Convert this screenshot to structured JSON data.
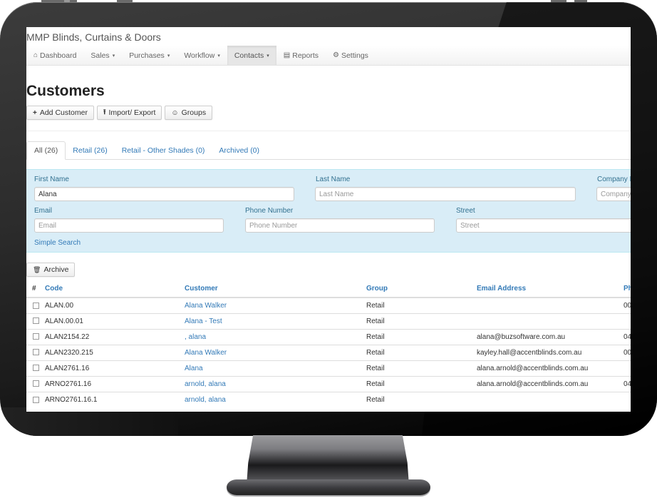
{
  "app": {
    "title": "MMP Blinds, Curtains & Doors"
  },
  "nav": {
    "items": [
      {
        "label": "Dashboard",
        "icon": "home-icon",
        "glyph": "⌂",
        "caret": ""
      },
      {
        "label": "Sales",
        "icon": "",
        "glyph": "",
        "caret": "▾"
      },
      {
        "label": "Purchases",
        "icon": "",
        "glyph": "",
        "caret": "▾"
      },
      {
        "label": "Workflow",
        "icon": "",
        "glyph": "",
        "caret": "▾"
      },
      {
        "label": "Contacts",
        "icon": "",
        "glyph": "",
        "caret": "▾",
        "active": true
      },
      {
        "label": "Reports",
        "icon": "bar-chart-icon",
        "glyph": "▤",
        "caret": ""
      },
      {
        "label": "Settings",
        "icon": "gears-icon",
        "glyph": "⚙",
        "caret": ""
      }
    ]
  },
  "page": {
    "title": "Customers"
  },
  "toolbar": {
    "add_customer": {
      "label": "Add Customer",
      "glyph": "+"
    },
    "import_export": {
      "label": "Import/ Export",
      "glyph": "⭱"
    },
    "groups": {
      "label": "Groups",
      "glyph": "☺"
    }
  },
  "tabs": [
    {
      "label": "All (26)",
      "active": true
    },
    {
      "label": "Retail (26)"
    },
    {
      "label": "Retail - Other Shades (0)"
    },
    {
      "label": "Archived (0)"
    }
  ],
  "search": {
    "first_name": {
      "label": "First Name",
      "value": "Alana",
      "placeholder": "First Name"
    },
    "last_name": {
      "label": "Last Name",
      "value": "",
      "placeholder": "Last Name"
    },
    "company_name": {
      "label": "Company Name",
      "value": "",
      "placeholder": "Company Name"
    },
    "email": {
      "label": "Email",
      "value": "",
      "placeholder": "Email"
    },
    "phone": {
      "label": "Phone Number",
      "value": "",
      "placeholder": "Phone Number"
    },
    "street": {
      "label": "Street",
      "value": "",
      "placeholder": "Street"
    },
    "simple_search_label": "Simple Search"
  },
  "archive_button": {
    "label": "Archive",
    "glyph": "🗑"
  },
  "table": {
    "columns": [
      "#",
      "Code",
      "Customer",
      "Group",
      "Email Address",
      "Phone"
    ],
    "rows": [
      {
        "code": "ALAN.00",
        "customer": "Alana Walker",
        "group": "Retail",
        "email": "",
        "phone": "00"
      },
      {
        "code": "ALAN.00.01",
        "customer": "Alana - Test",
        "group": "Retail",
        "email": "",
        "phone": ""
      },
      {
        "code": "ALAN2154.22",
        "customer": ", alana",
        "group": "Retail",
        "email": "alana@buzsoftware.com.au",
        "phone": "04"
      },
      {
        "code": "ALAN2320.215",
        "customer": "Alana Walker",
        "group": "Retail",
        "email": "kayley.hall@accentblinds.com.au",
        "phone": "00"
      },
      {
        "code": "ALAN2761.16",
        "customer": "Alana",
        "group": "Retail",
        "email": "alana.arnold@accentblinds.com.au",
        "phone": ""
      },
      {
        "code": "ARNO2761.16",
        "customer": "arnold, alana",
        "group": "Retail",
        "email": "alana.arnold@accentblinds.com.au",
        "phone": "04"
      },
      {
        "code": "ARNO2761.16.1",
        "customer": "arnold, alana",
        "group": "Retail",
        "email": "",
        "phone": ""
      }
    ]
  },
  "colors": {
    "link": "#337ab7",
    "search_panel_bg": "#d9edf7",
    "search_label": "#31708f"
  }
}
